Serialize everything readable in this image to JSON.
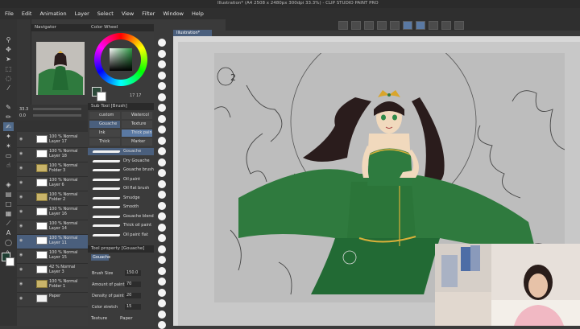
{
  "window": {
    "title": "Illustration* (A4 2508 x 2480px 300dpi 33.3%) - CLIP STUDIO PAINT PRO"
  },
  "menu": [
    "File",
    "Edit",
    "Animation",
    "Layer",
    "Select",
    "View",
    "Filter",
    "Window",
    "Help"
  ],
  "panels": {
    "navigator": "Navigator",
    "color_wheel": "Color Wheel",
    "color_values": "17   17",
    "subtool": "Sub Tool [Brush]",
    "tool_property": "Tool property [Gouache]",
    "canvas_tab": "Illustration*"
  },
  "layer_property": {
    "zoom": "33.3",
    "opacity": "0.0"
  },
  "layers": [
    {
      "label": "100 % Normal\nLayer 17",
      "kind": "layer"
    },
    {
      "label": "100 % Normal\nLayer 18",
      "kind": "layer"
    },
    {
      "label": "100 % Normal\nFolder 3",
      "kind": "folder"
    },
    {
      "label": "100 % Normal\nLayer 6",
      "kind": "layer"
    },
    {
      "label": "100 % Normal\nFolder 2",
      "kind": "folder"
    },
    {
      "label": "100 % Normal\nLayer 16",
      "kind": "layer"
    },
    {
      "label": "100 % Normal\nLayer 14",
      "kind": "layer"
    },
    {
      "label": "100 % Normal\nLayer 11",
      "kind": "layer",
      "selected": true
    },
    {
      "label": "100 % Normal\nLayer 15",
      "kind": "layer"
    },
    {
      "label": "42 % Normal\nLayer 3",
      "kind": "layer"
    },
    {
      "label": "100 % Normal\nFolder 1",
      "kind": "folder"
    },
    {
      "label": "Paper",
      "kind": "paper"
    }
  ],
  "subtool_groups": [
    "custom",
    "Watercol",
    "Gouache",
    "Texture",
    "Thick",
    "Thick pain",
    "Ink",
    "Marker"
  ],
  "brushes": [
    "Gouache",
    "Dry Gouache",
    "Gouache brush",
    "Oil paint",
    "Oil flat brush",
    "Smudge",
    "Smooth",
    "Gouache blend",
    "Thick oil paint",
    "Oil paint flat"
  ],
  "tool_property": [
    {
      "label": "Brush Size",
      "value": "150.0"
    },
    {
      "label": "Amount of paint",
      "value": "70"
    },
    {
      "label": "Density of paint",
      "value": "20"
    },
    {
      "label": "Color stretch",
      "value": "15"
    }
  ],
  "bottom_tabs": [
    "Texture",
    "Paper"
  ],
  "annotation": "2",
  "accent": "#4a5f7d",
  "dress_color": "#2f7a3e"
}
